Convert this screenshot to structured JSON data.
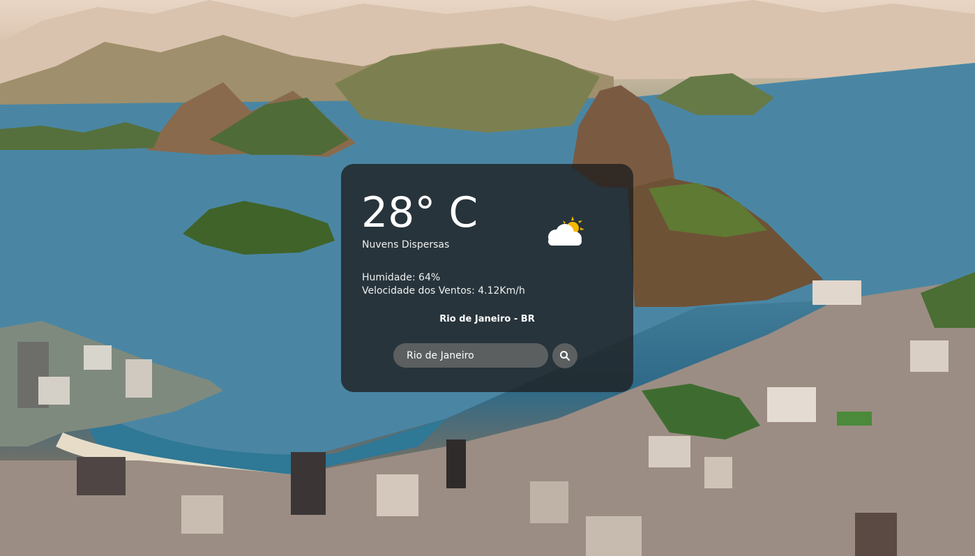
{
  "weather": {
    "temperature": "28° C",
    "description": "Nuvens Dispersas",
    "humidity": "Humidade: 64%",
    "wind_speed": "Velocidade dos Ventos: 4.12Km/h",
    "location": "Rio de Janeiro - BR",
    "icon": "scattered-clouds-icon"
  },
  "search": {
    "value": "Rio de Janeiro",
    "button_icon": "search-icon"
  },
  "colors": {
    "card_background": "#1e1e1e",
    "input_background": "#6e6e6e",
    "text": "#ffffff",
    "sun": "#f5b700"
  }
}
